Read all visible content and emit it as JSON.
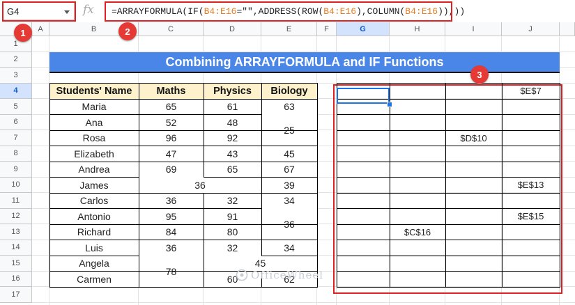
{
  "formula_bar": {
    "name_box": "G4",
    "fx_symbol": "fx",
    "formula_parts": [
      {
        "text": "=ARRAYFORMULA(IF(",
        "ref": false
      },
      {
        "text": "B4:E16",
        "ref": true
      },
      {
        "text": "=\"\",ADDRESS(ROW(",
        "ref": false
      },
      {
        "text": "B4:E16",
        "ref": true
      },
      {
        "text": "),COLUMN(",
        "ref": false
      },
      {
        "text": "B4:E16",
        "ref": true
      },
      {
        "text": ")),))",
        "ref": false
      }
    ]
  },
  "badges": [
    "1",
    "2",
    "3"
  ],
  "columns": [
    "A",
    "B",
    "C",
    "D",
    "E",
    "F",
    "G",
    "H",
    "I",
    "J"
  ],
  "rows": [
    "1",
    "2",
    "3",
    "4",
    "5",
    "6",
    "7",
    "8",
    "9",
    "10",
    "11",
    "12",
    "13",
    "14",
    "15",
    "16",
    "17"
  ],
  "selected": {
    "column": "G",
    "row": "4"
  },
  "title": "Combining ARRAYFORMULA and IF Functions",
  "table": {
    "headers": [
      "Students' Name",
      "Maths",
      "Physics",
      "Biology"
    ],
    "names": [
      "Maria",
      "Ana",
      "Rosa",
      "Elizabeth",
      "Andrea",
      "James",
      "Carlos",
      "Antonio",
      "Richard",
      "Luis",
      "Angela",
      "Carmen"
    ],
    "cells": [
      {
        "r": 0,
        "c": 1,
        "v": "65"
      },
      {
        "r": 0,
        "c": 2,
        "v": "61"
      },
      {
        "r": 0,
        "c": 3,
        "v": "63"
      },
      {
        "r": 1,
        "c": 1,
        "v": "52"
      },
      {
        "r": 1,
        "c": 2,
        "v": "48"
      },
      {
        "r": 1,
        "c": 3,
        "v": "25",
        "rs": 2
      },
      {
        "r": 2,
        "c": 1,
        "v": "96"
      },
      {
        "r": 2,
        "c": 2,
        "v": "92"
      },
      {
        "r": 3,
        "c": 1,
        "v": "47"
      },
      {
        "r": 3,
        "c": 2,
        "v": "43"
      },
      {
        "r": 3,
        "c": 3,
        "v": "45"
      },
      {
        "r": 4,
        "c": 1,
        "v": "69"
      },
      {
        "r": 4,
        "c": 2,
        "v": "65"
      },
      {
        "r": 4,
        "c": 3,
        "v": "67"
      },
      {
        "r": 5,
        "c": 1,
        "v": "36",
        "cs": 2
      },
      {
        "r": 5,
        "c": 3,
        "v": "39"
      },
      {
        "r": 6,
        "c": 1,
        "v": "36"
      },
      {
        "r": 6,
        "c": 2,
        "v": "32"
      },
      {
        "r": 6,
        "c": 3,
        "v": "34"
      },
      {
        "r": 7,
        "c": 1,
        "v": "95"
      },
      {
        "r": 7,
        "c": 2,
        "v": "91"
      },
      {
        "r": 7,
        "c": 3,
        "v": "36",
        "rs": 2
      },
      {
        "r": 8,
        "c": 1,
        "v": "84"
      },
      {
        "r": 8,
        "c": 2,
        "v": "80"
      },
      {
        "r": 9,
        "c": 1,
        "v": "36"
      },
      {
        "r": 9,
        "c": 2,
        "v": "32"
      },
      {
        "r": 9,
        "c": 3,
        "v": "34"
      },
      {
        "r": 10,
        "c": 1,
        "v": "78",
        "rs": 2
      },
      {
        "r": 10,
        "c": 2,
        "v": "45",
        "cs": 2
      },
      {
        "r": 11,
        "c": 2,
        "v": "60"
      },
      {
        "r": 11,
        "c": 3,
        "v": "62"
      }
    ]
  },
  "outputs": [
    {
      "row": 3,
      "col": 3,
      "v": "$E$7"
    },
    {
      "row": 6,
      "col": 2,
      "v": "$D$10"
    },
    {
      "row": 9,
      "col": 3,
      "v": "$E$13"
    },
    {
      "row": 11,
      "col": 3,
      "v": "$E$15"
    },
    {
      "row": 12,
      "col": 1,
      "v": "$C$16"
    }
  ],
  "watermark": "OfficeWheel",
  "colors": {
    "title_bg": "#4a86e8",
    "header_bg": "#fdf2cc",
    "highlight": "#e02020",
    "selection": "#1a73e8"
  }
}
